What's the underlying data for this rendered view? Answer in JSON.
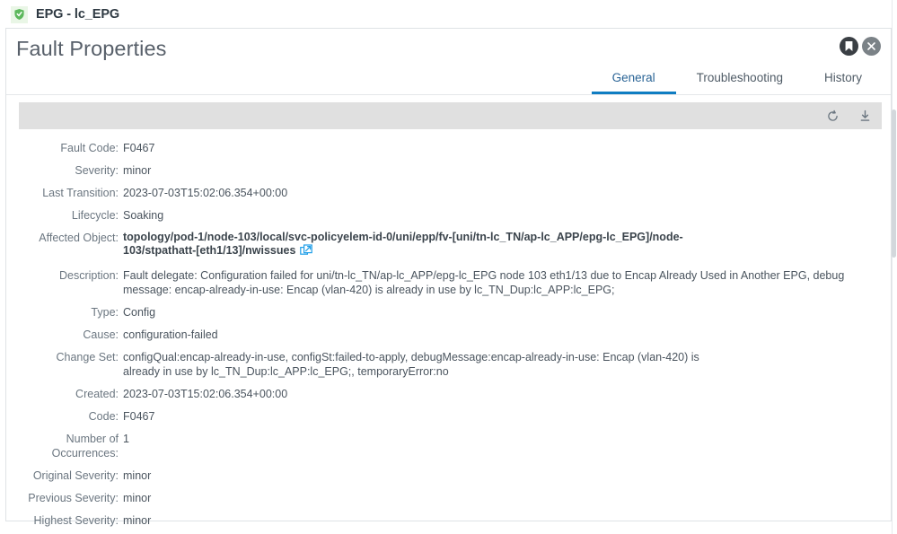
{
  "page_header": {
    "icon": "epg-shield-icon",
    "title": "EPG - lc_EPG"
  },
  "card": {
    "title": "Fault Properties",
    "head_icons": [
      {
        "name": "bookmark-icon",
        "label": "Bookmark"
      },
      {
        "name": "close-icon",
        "label": "Close"
      }
    ],
    "tabs": [
      {
        "label": "General",
        "active": true
      },
      {
        "label": "Troubleshooting",
        "active": false
      },
      {
        "label": "History",
        "active": false
      }
    ],
    "toolbar": [
      {
        "name": "refresh-icon",
        "label": "Refresh"
      },
      {
        "name": "download-icon",
        "label": "Download"
      }
    ]
  },
  "properties": {
    "fault_code_label": "Fault Code:",
    "fault_code_value": "F0467",
    "severity_label": "Severity:",
    "severity_value": "minor",
    "last_transition_label": "Last Transition:",
    "last_transition_value": "2023-07-03T15:02:06.354+00:00",
    "lifecycle_label": "Lifecycle:",
    "lifecycle_value": "Soaking",
    "affected_object_label": "Affected Object:",
    "affected_object_value": "topology/pod-1/node-103/local/svc-policyelem-id-0/uni/epp/fv-[uni/tn-lc_TN/ap-lc_APP/epg-lc_EPG]/node-103/stpathatt-[eth1/13]/nwissues",
    "description_label": "Description:",
    "description_value": "Fault delegate: Configuration failed for uni/tn-lc_TN/ap-lc_APP/epg-lc_EPG node 103 eth1/13 due to Encap Already Used in Another EPG, debug message: encap-already-in-use: Encap (vlan-420) is already in use by lc_TN_Dup:lc_APP:lc_EPG;",
    "type_label": "Type:",
    "type_value": "Config",
    "cause_label": "Cause:",
    "cause_value": "configuration-failed",
    "change_set_label": "Change Set:",
    "change_set_value": "configQual:encap-already-in-use, configSt:failed-to-apply, debugMessage:encap-already-in-use: Encap (vlan-420) is already in use by lc_TN_Dup:lc_APP:lc_EPG;, temporaryError:no",
    "created_label": "Created:",
    "created_value": "2023-07-03T15:02:06.354+00:00",
    "code_label": "Code:",
    "code_value": "F0467",
    "number_of_occurrences_label": "Number of Occurrences:",
    "number_of_occurrences_value": "1",
    "original_severity_label": "Original Severity:",
    "original_severity_value": "minor",
    "previous_severity_label": "Previous Severity:",
    "previous_severity_value": "minor",
    "highest_severity_label": "Highest Severity:",
    "highest_severity_value": "minor"
  },
  "colors": {
    "accent_blue": "#0f7dc2",
    "tab_active_text": "#2a6496",
    "badge_green": "#5cb85c",
    "badge_bg": "#e9f6e6",
    "toolbar_gray": "#e0e0e0",
    "link_blue": "#1f9ee8"
  }
}
